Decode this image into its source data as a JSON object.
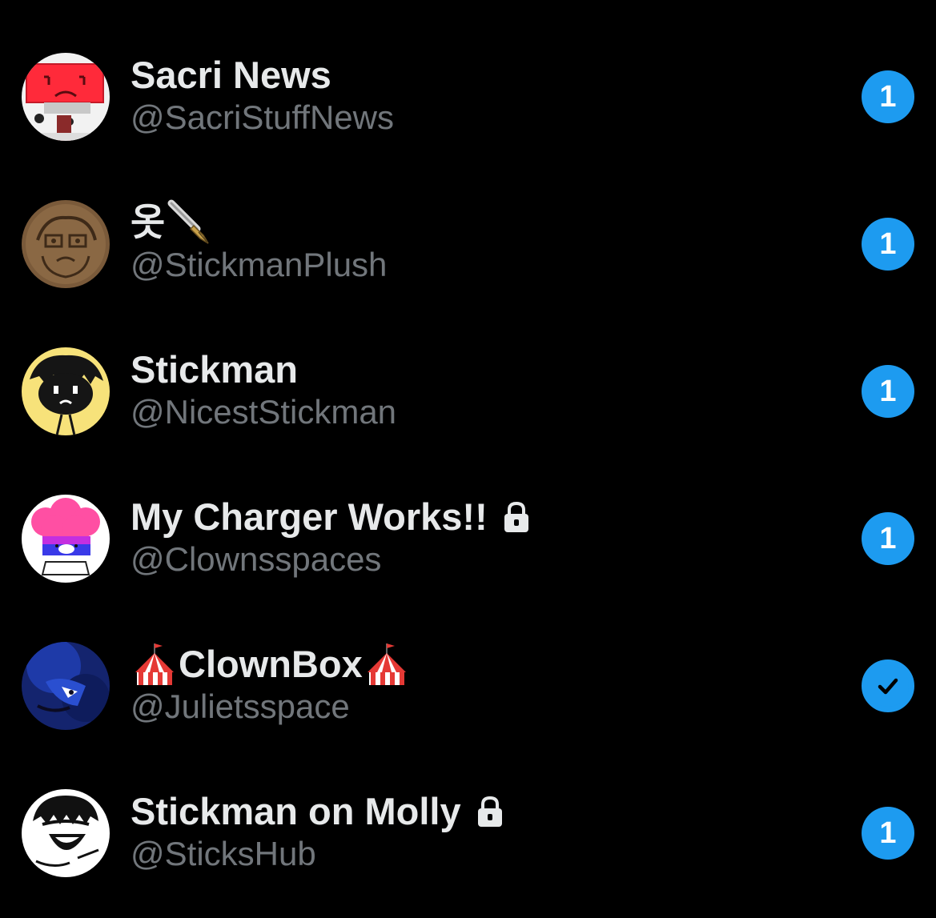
{
  "accent_color": "#1d9bf0",
  "background_color": "#000000",
  "rows": [
    {
      "avatar_icon": "red-character-avatar",
      "display_name": "Sacri News",
      "handle": "@SacriStuffNews",
      "locked": false,
      "badge": "1"
    },
    {
      "avatar_icon": "brown-sketch-avatar",
      "display_name_prefix": "옷",
      "display_name_emoji": "fountain-pen-icon",
      "handle": "@StickmanPlush",
      "locked": false,
      "badge": "1"
    },
    {
      "avatar_icon": "yellow-stickman-avatar",
      "display_name": "Stickman",
      "handle": "@NicestStickman",
      "locked": false,
      "badge": "1"
    },
    {
      "avatar_icon": "pink-clown-avatar",
      "display_name": "My Charger Works!!",
      "handle": "@Clownsspaces",
      "locked": true,
      "badge": "1"
    },
    {
      "avatar_icon": "blue-character-avatar",
      "display_name": "ClownBox",
      "display_name_emoji": "circus-tent-icon",
      "handle": "@Julietsspace",
      "locked": false,
      "badge_icon": "checkmark-icon"
    },
    {
      "avatar_icon": "laughing-stickman-avatar",
      "display_name": "Stickman on Molly",
      "handle": "@SticksHub",
      "locked": true,
      "badge": "1"
    }
  ]
}
